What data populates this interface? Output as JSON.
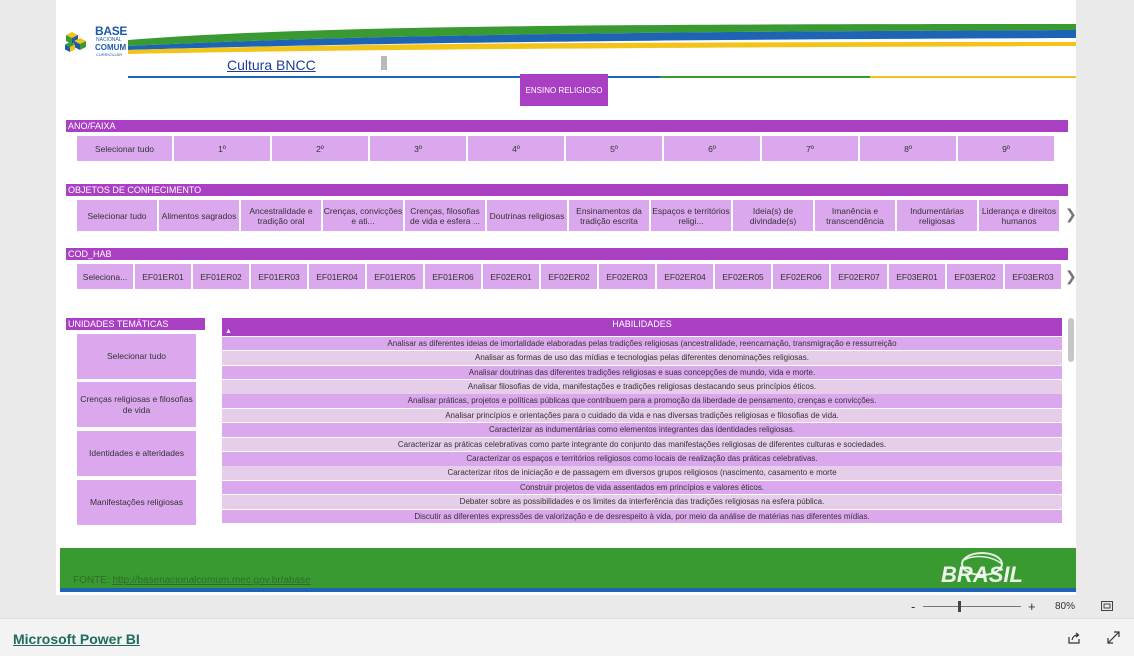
{
  "header": {
    "logo": {
      "line1": "BASE",
      "line2": "NACIONAL",
      "line3": "COMUM",
      "line4": "CURRICULAR"
    },
    "title": "Cultura BNCC"
  },
  "ensino_button": "ENSINO RELIGIOSO",
  "ano_faixa": {
    "title": "ANO/FAIXA",
    "items": [
      "Selecionar tudo",
      "1º",
      "2º",
      "3º",
      "4º",
      "5º",
      "6º",
      "7º",
      "8º",
      "9º"
    ]
  },
  "objetos": {
    "title": "OBJETOS DE CONHECIMENTO",
    "items": [
      "Selecionar tudo",
      "Alimentos sagrados",
      "Ancestralidade e tradição oral",
      "Crenças, convicções e ati...",
      "Crenças, filosofias de vida e esfera ...",
      "Doutrinas religiosas",
      "Ensinamentos da tradição escrita",
      "Espaços e territórios religi...",
      "Ideia(s) de divindade(s)",
      "Imanência e transcendência",
      "Indumentárias religiosas",
      "Liderança e direitos humanos"
    ]
  },
  "cod_hab": {
    "title": "COD_HAB",
    "items": [
      "Seleciona...",
      "EF01ER01",
      "EF01ER02",
      "EF01ER03",
      "EF01ER04",
      "EF01ER05",
      "EF01ER06",
      "EF02ER01",
      "EF02ER02",
      "EF02ER03",
      "EF02ER04",
      "EF02ER05",
      "EF02ER06",
      "EF02ER07",
      "EF03ER01",
      "EF03ER02",
      "EF03ER03"
    ]
  },
  "unidades": {
    "title": "UNIDADES TEMÁTICAS",
    "items": [
      "Selecionar tudo",
      "Crenças religiosas e filosofias de vida",
      "Identidades e alteridades",
      "Manifestações religiosas"
    ]
  },
  "habilidades": {
    "title": "HABILIDADES",
    "rows": [
      "Analisar as diferentes ideias de imortalidade elaboradas pelas tradições religiosas (ancestralidade, reencarnação, transmigração e ressurreição",
      "Analisar as formas de uso das mídias e tecnologias pelas diferentes denominações religiosas.",
      "Analisar doutrinas das diferentes tradições religiosas e suas concepções de mundo, vida e morte.",
      "Analisar filosofias de vida, manifestações e tradições religiosas destacando seus princípios éticos.",
      "Analisar práticas, projetos e políticas públicas que contribuem para a promoção da liberdade de pensamento, crenças e convicções.",
      "Analisar princípios e orientações para o cuidado da vida e nas diversas tradições religiosas e filosofias de vida.",
      "Caracterizar as indumentárias como elementos integrantes das identidades religiosas.",
      "Caracterizar as práticas celebrativas como parte integrante do conjunto das manifestações religiosas de diferentes culturas e sociedades.",
      "Caracterizar os espaços e territórios religiosos como locais de realização das práticas celebrativas.",
      "Caracterizar ritos de iniciação e de passagem em diversos grupos religiosos (nascimento, casamento e morte",
      "Construir projetos de vida assentados em princípios e valores éticos.",
      "Debater sobre as possibilidades e os limites da interferência das tradições religiosas na esfera pública.",
      "Discutir as diferentes expressões de valorização e de desrespeito à vida, por meio da análise de matérias nas diferentes mídias."
    ]
  },
  "footer": {
    "fonte_label": "FONTE:",
    "fonte_url": "http://basenacionalcomum.mec.gov.br/abase",
    "brasil_text": "BRASIL"
  },
  "statusbar": {
    "zoom_minus": "-",
    "zoom_plus": "+",
    "zoom_level": "80%",
    "zoom_fraction": 0.37
  },
  "bottombar": {
    "powerbi_label": "Microsoft Power BI"
  },
  "colors": {
    "accent": "#a940c4",
    "slicer": "#dba8ee",
    "green": "#3a9a32",
    "blue": "#1e64b4"
  }
}
